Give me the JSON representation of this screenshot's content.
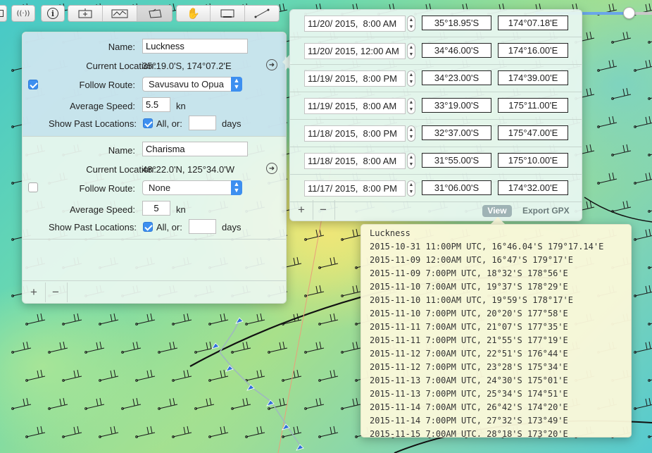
{
  "toolbar": {
    "buttons": [
      {
        "name": "sidebar-toggle-icon"
      },
      {
        "name": "broadcast-icon"
      },
      {
        "name": "info-icon"
      }
    ],
    "tools": [
      {
        "name": "add-boat-icon"
      },
      {
        "name": "route-icon"
      },
      {
        "name": "boat-location-icon",
        "active": true
      },
      {
        "name": "pan-hand-icon"
      },
      {
        "name": "rectangle-select-icon"
      },
      {
        "name": "measure-line-icon"
      }
    ]
  },
  "boats": [
    {
      "name_label": "Name:",
      "name_value": "Luckness",
      "current_location_label": "Current Location:",
      "current_location_value": "35°19.0'S, 174°07.2'E",
      "follow_route_label": "Follow Route:",
      "follow_route_checked": true,
      "follow_route_value": "Savusavu to Opua",
      "average_speed_label": "Average Speed:",
      "average_speed_value": "5.5",
      "speed_unit": "kn",
      "show_past_label": "Show Past Locations:",
      "all_label": "All, or:",
      "all_checked": true,
      "days_value": "",
      "days_unit": "days"
    },
    {
      "name_label": "Name:",
      "name_value": "Charisma",
      "current_location_label": "Current Location:",
      "current_location_value": "48°22.0'N, 125°34.0'W",
      "follow_route_label": "Follow Route:",
      "follow_route_checked": false,
      "follow_route_value": "None",
      "average_speed_label": "Average Speed:",
      "average_speed_value": "5",
      "speed_unit": "kn",
      "show_past_label": "Show Past Locations:",
      "all_label": "All, or:",
      "all_checked": true,
      "days_value": "",
      "days_unit": "days"
    }
  ],
  "boats_footer": {
    "add": "+",
    "remove": "−"
  },
  "locations": [
    {
      "date": "11/20/ 2015,  8:00 AM",
      "lat": "35°18.95'S",
      "lon": "174°07.18'E"
    },
    {
      "date": "11/20/ 2015, 12:00 AM",
      "lat": "34°46.00'S",
      "lon": "174°16.00'E"
    },
    {
      "date": "11/19/ 2015,  8:00 PM",
      "lat": "34°23.00'S",
      "lon": "174°39.00'E"
    },
    {
      "date": "11/19/ 2015,  8:00 AM",
      "lat": "33°19.00'S",
      "lon": "175°11.00'E"
    },
    {
      "date": "11/18/ 2015,  8:00 PM",
      "lat": "32°37.00'S",
      "lon": "175°47.00'E"
    },
    {
      "date": "11/18/ 2015,  8:00 AM",
      "lat": "31°55.00'S",
      "lon": "175°10.00'E"
    },
    {
      "date": "11/17/ 2015,  8:00 PM",
      "lat": "31°06.00'S",
      "lon": "174°32.00'E"
    }
  ],
  "locations_footer": {
    "add": "+",
    "remove": "−",
    "view": "View",
    "export": "Export GPX"
  },
  "gpx": {
    "lines": [
      "Luckness",
      "2015-10-31 11:00PM UTC, 16°46.04'S 179°17.14'E",
      "2015-11-09 12:00AM UTC, 16°47'S 179°17'E",
      "2015-11-09 7:00PM UTC, 18°32'S 178°56'E",
      "2015-11-10 7:00AM UTC, 19°37'S 178°29'E",
      "2015-11-10 11:00AM UTC, 19°59'S 178°17'E",
      "2015-11-10 7:00PM UTC, 20°20'S 177°58'E",
      "2015-11-11 7:00AM UTC, 21°07'S 177°35'E",
      "2015-11-11 7:00PM UTC, 21°55'S 177°19'E",
      "2015-11-12 7:00AM UTC, 22°51'S 176°44'E",
      "2015-11-12 7:00PM UTC, 23°28'S 175°34'E",
      "2015-11-13 7:00AM UTC, 24°30'S 175°01'E",
      "2015-11-13 7:00PM UTC, 25°34'S 174°51'E",
      "2015-11-14 7:00AM UTC, 26°42'S 174°20'E",
      "2015-11-14 7:00PM UTC, 27°32'S 173°49'E",
      "2015-11-15 7:00AM UTC, 28°18'S 173°20'E"
    ]
  },
  "colors": {
    "accent": "#3d8ff0",
    "route_line": "#000000",
    "boat_marker": "#2f6fd8"
  }
}
